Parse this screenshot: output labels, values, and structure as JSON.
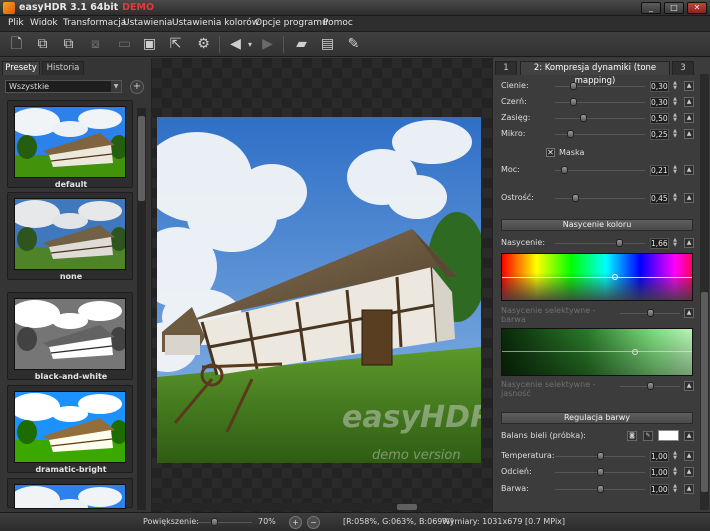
{
  "window": {
    "title": "easyHDR 3.1  64bit",
    "demo_badge": "DEMO",
    "controls": {
      "minimize": "_",
      "maximize": "□",
      "close": "✕"
    }
  },
  "menu": [
    "Plik",
    "Widok",
    "Transformacja",
    "Ustawienia",
    "Ustawienia kolorów",
    "Opcje programu",
    "Pomoc"
  ],
  "toolbar": {
    "icons": [
      "new-file-icon",
      "batch-icon",
      "batch-settings-icon",
      "stack-icon",
      "save-icon",
      "save-as-icon",
      "export-icon",
      "settings-gear-icon",
      "back-icon",
      "forward-icon",
      "open-folder-icon",
      "save-settings-icon",
      "stamp-icon"
    ]
  },
  "left_panel": {
    "tabs": [
      "Presety",
      "Historia"
    ],
    "active_tab": "Presety",
    "filter": {
      "value": "Wszystkie"
    },
    "add_button": "+",
    "presets": [
      {
        "label": "default",
        "style": "default"
      },
      {
        "label": "none",
        "style": "none"
      },
      {
        "label": "black-and-white",
        "style": "bw"
      },
      {
        "label": "dramatic-bright",
        "style": "bright"
      }
    ]
  },
  "image": {
    "watermark": "easyHDR",
    "watermark_sub": "demo version"
  },
  "right_panel": {
    "tabs": [
      "1",
      "2: Kompresja dynamiki (tone mapping)",
      "3"
    ],
    "active_tab": "2: Kompresja dynamiki (tone mapping)",
    "sliders": [
      {
        "label": "Cienie:",
        "value": "0,30",
        "level": 0.18
      },
      {
        "label": "Czerń:",
        "value": "0,30",
        "level": 0.18
      },
      {
        "label": "Zasięg:",
        "value": "0,50",
        "level": 0.3
      },
      {
        "label": "Mikro:",
        "value": "0,25",
        "level": 0.15
      }
    ],
    "mask": {
      "label": "Maska",
      "checked": true
    },
    "power": {
      "label": "Moc:",
      "value": "0,21",
      "level": 0.07
    },
    "sharpness": {
      "label": "Ostrość:",
      "value": "0,45",
      "level": 0.2
    },
    "saturation_section": "Nasycenie koloru",
    "saturation": {
      "label": "Nasycenie:",
      "value": "1,66",
      "level": 0.73
    },
    "selective_hue": {
      "label": "Nasycenie selektywne - barwa",
      "level": 0.5
    },
    "selective_lum": {
      "label": "Nasycenie selektywne - jasność",
      "level": 0.5
    },
    "color_section": "Regulacja barwy",
    "white_balance": {
      "label": "Balans bieli (próbka):",
      "swatch": "#ffffff"
    },
    "color_sliders": [
      {
        "label": "Temperatura:",
        "value": "1,00",
        "level": 0.5
      },
      {
        "label": "Odcień:",
        "value": "1,00",
        "level": 0.5
      },
      {
        "label": "Barwa:",
        "value": "1,00",
        "level": 0.5
      }
    ]
  },
  "status": {
    "zoom_label": "Powiększenie:",
    "zoom_value": "70%",
    "zoom_level": 0.3,
    "rgb": "[R:058%, G:063%, B:069%]",
    "dimensions": "Wymiary:  1031x679 [0.7 MPix]"
  },
  "colors": {
    "accent": "#f7a41d",
    "demo": "#e23b3b",
    "panel": "#3c3c3c"
  }
}
